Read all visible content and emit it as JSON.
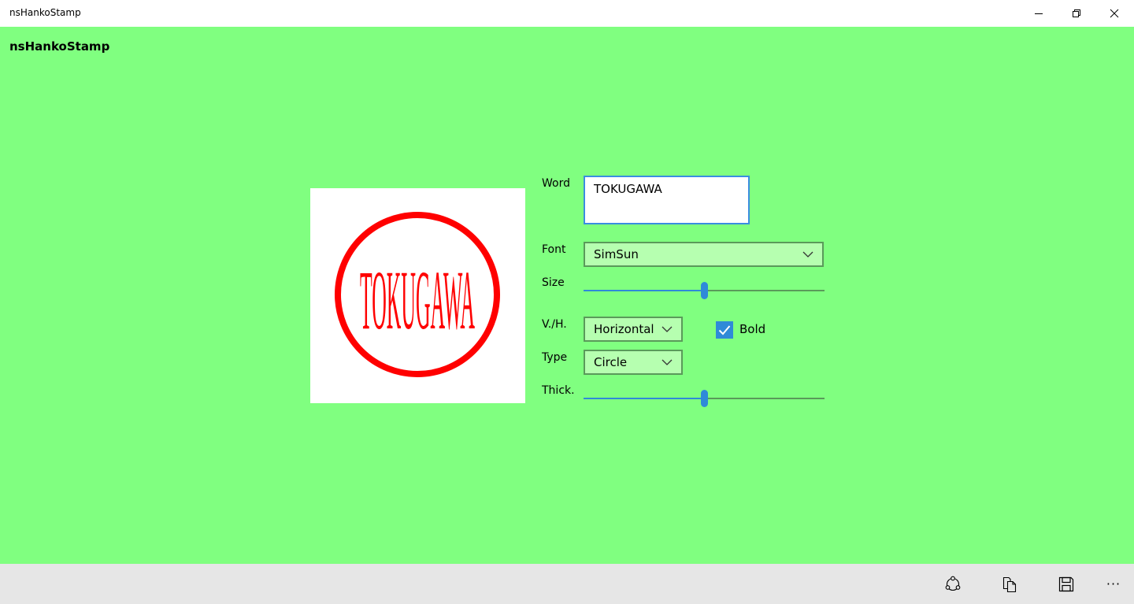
{
  "window": {
    "title": "nsHankoStamp"
  },
  "app": {
    "title": "nsHankoStamp"
  },
  "stamp": {
    "text": "TOKUGAWA",
    "color": "#ff0000"
  },
  "form": {
    "word_label": "Word",
    "word_value": "TOKUGAWA",
    "font_label": "Font",
    "font_value": "SimSun",
    "size_label": "Size",
    "size_level_percent": 50,
    "vh_label": "V./H.",
    "vh_value": "Horizontal",
    "bold_label": "Bold",
    "bold_checked": true,
    "type_label": "Type",
    "type_value": "Circle",
    "thick_label": "Thick.",
    "thick_level_percent": 50
  },
  "appbar": {
    "more_label": "···",
    "icons": [
      "share-icon",
      "copy-icon",
      "save-icon",
      "more-icon"
    ]
  },
  "colors": {
    "background": "#80ff80",
    "accent": "#2f8ad8",
    "combo_fill": "#b6ffb0",
    "appbar": "#e6e6e6"
  }
}
